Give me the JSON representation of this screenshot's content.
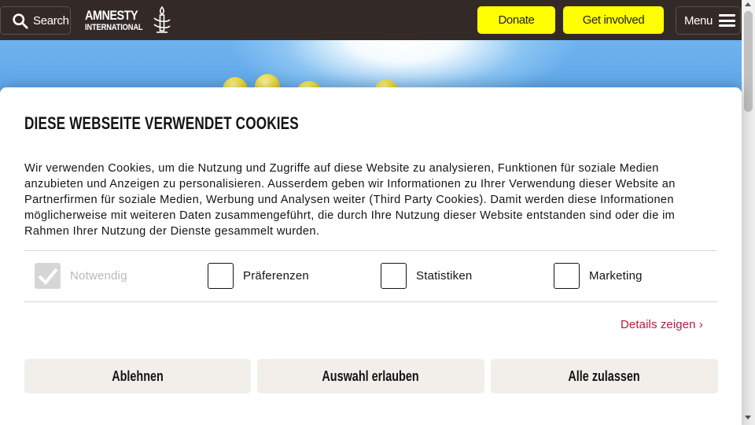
{
  "header": {
    "search_label": "Search",
    "logo_line1": "AMNESTY",
    "logo_line2": "INTERNATIONAL",
    "donate_label": "Donate",
    "get_involved_label": "Get involved",
    "menu_label": "Menu"
  },
  "cookie_dialog": {
    "title": "DIESE WEBSEITE VERWENDET COOKIES",
    "body": "Wir verwenden Cookies, um die Nutzung und Zugriffe auf diese Website zu analysieren, Funktionen für soziale Medien anzubieten und Anzeigen zu personalisieren. Ausserdem geben wir Informationen zu Ihrer Verwendung dieser Website an Partnerfirmen für soziale Medien, Werbung und Analysen weiter (Third Party Cookies). Damit werden diese Informationen möglicherweise mit weiteren Daten zusammengeführt, die durch Ihre Nutzung dieser Website entstanden sind oder die im Rahmen Ihrer Nutzung der Dienste gesammelt wurden.",
    "options": [
      {
        "label": "Notwendig",
        "checked": true,
        "disabled": true
      },
      {
        "label": "Präferenzen",
        "checked": false,
        "disabled": false
      },
      {
        "label": "Statistiken",
        "checked": false,
        "disabled": false
      },
      {
        "label": "Marketing",
        "checked": false,
        "disabled": false
      }
    ],
    "details_label": "Details zeigen",
    "details_chevron": "›",
    "buttons": {
      "reject": "Ablehnen",
      "allow_selection": "Auswahl erlauben",
      "allow_all": "Alle zulassen"
    }
  },
  "colors": {
    "header_bg": "#332a27",
    "accent_yellow": "#ffff00",
    "link_red": "#b5193c",
    "button_grey": "#f2efeb"
  }
}
